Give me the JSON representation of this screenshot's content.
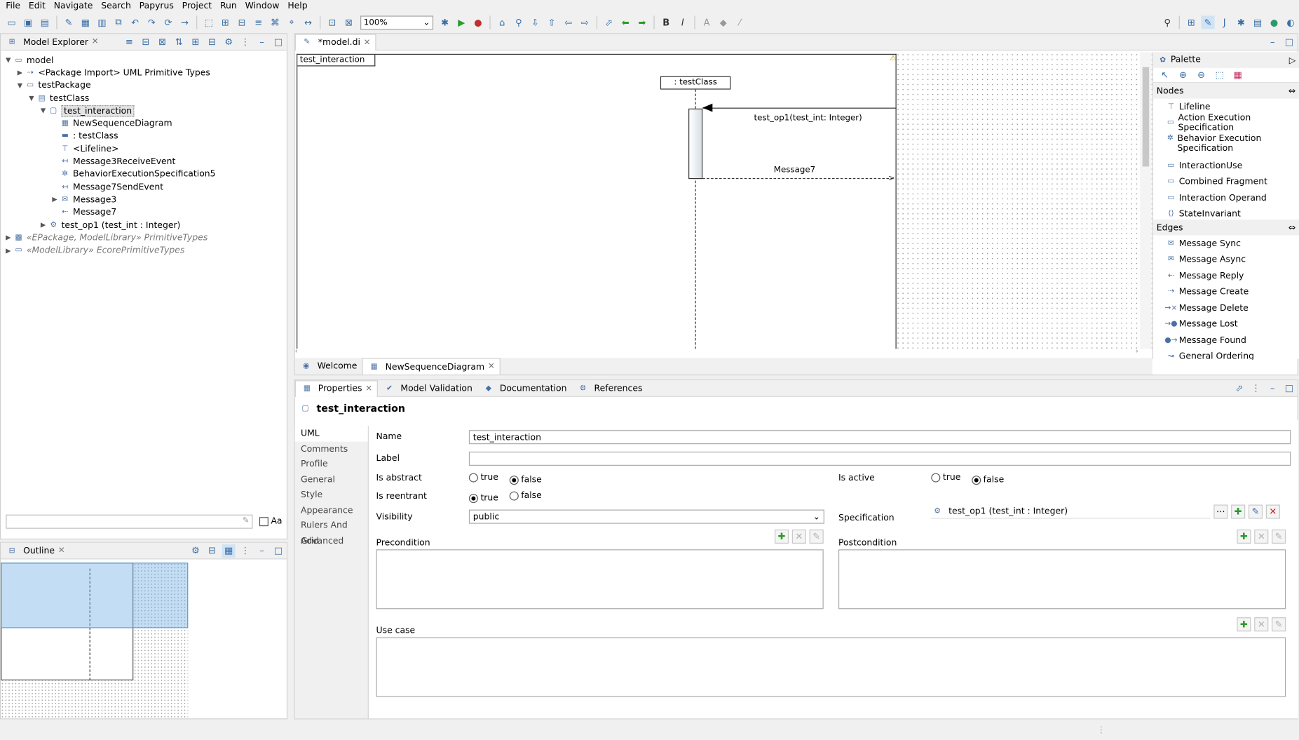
{
  "menu": [
    "File",
    "Edit",
    "Navigate",
    "Search",
    "Papyrus",
    "Project",
    "Run",
    "Window",
    "Help"
  ],
  "toolbar": {
    "zoom": "100%"
  },
  "model_explorer": {
    "title": "Model Explorer",
    "tree": [
      {
        "label": "model",
        "indent": 0,
        "exp": "v",
        "icon": "folder-icon"
      },
      {
        "label": "<Package Import> UML Primitive Types",
        "indent": 1,
        "exp": ">",
        "icon": "package-import-icon"
      },
      {
        "label": "testPackage",
        "indent": 1,
        "exp": "v",
        "icon": "package-icon"
      },
      {
        "label": "testClass",
        "indent": 2,
        "exp": "v",
        "icon": "class-icon"
      },
      {
        "label": "test_interaction",
        "indent": 3,
        "exp": "v",
        "icon": "interaction-icon",
        "selected": true
      },
      {
        "label": "NewSequenceDiagram",
        "indent": 4,
        "exp": "",
        "icon": "diagram-icon"
      },
      {
        "label": ": testClass",
        "indent": 4,
        "exp": "",
        "icon": "property-icon"
      },
      {
        "label": "<Lifeline>",
        "indent": 4,
        "exp": "",
        "icon": "lifeline-icon"
      },
      {
        "label": "Message3ReceiveEvent",
        "indent": 4,
        "exp": "",
        "icon": "event-icon"
      },
      {
        "label": "BehaviorExecutionSpecification5",
        "indent": 4,
        "exp": "",
        "icon": "execution-icon"
      },
      {
        "label": "Message7SendEvent",
        "indent": 4,
        "exp": "",
        "icon": "event-icon"
      },
      {
        "label": "Message3",
        "indent": 4,
        "exp": ">",
        "icon": "message-icon"
      },
      {
        "label": "Message7",
        "indent": 4,
        "exp": "",
        "icon": "reply-icon"
      },
      {
        "label": "test_op1 (test_int : Integer)",
        "indent": 3,
        "exp": ">",
        "icon": "operation-icon"
      },
      {
        "label": "«EPackage, ModelLibrary» PrimitiveTypes",
        "indent": 0,
        "exp": ">",
        "icon": "epackage-icon",
        "italic": true
      },
      {
        "label": "«ModelLibrary» EcorePrimitiveTypes",
        "indent": 0,
        "exp": ">",
        "icon": "model-library-icon",
        "italic": true
      }
    ],
    "filter_label": "Aa"
  },
  "outline": {
    "title": "Outline"
  },
  "editor": {
    "tab": "*model.di",
    "frame_label": "test_interaction",
    "lifeline": ": testClass",
    "msg1": "test_op1(test_int: Integer)",
    "msg2": "Message7",
    "bottom_tabs": [
      "Welcome",
      "NewSequenceDiagram"
    ]
  },
  "palette": {
    "title": "Palette",
    "nodes_title": "Nodes",
    "nodes": [
      "Lifeline",
      "Action Execution Specification",
      "Behavior Execution Specification",
      "InteractionUse",
      "Combined Fragment",
      "Interaction Operand",
      "StateInvariant"
    ],
    "edges_title": "Edges",
    "edges": [
      "Message Sync",
      "Message Async",
      "Message Reply",
      "Message Create",
      "Message Delete",
      "Message Lost",
      "Message Found",
      "General Ordering"
    ]
  },
  "properties": {
    "tabs": [
      "Properties",
      "Model Validation",
      "Documentation",
      "References"
    ],
    "title": "test_interaction",
    "side_tabs": [
      "UML",
      "Comments",
      "Profile",
      "General",
      "Style",
      "Appearance",
      "Rulers And Grid",
      "Advanced"
    ],
    "name_label": "Name",
    "name_value": "test_interaction",
    "label_label": "Label",
    "label_value": "",
    "is_abstract": "Is abstract",
    "is_active": "Is active",
    "is_reentrant": "Is reentrant",
    "true_label": "true",
    "false_label": "false",
    "visibility_label": "Visibility",
    "visibility_value": "public",
    "spec_label": "Specification",
    "spec_value": "test_op1 (test_int : Integer)",
    "precondition": "Precondition",
    "postcondition": "Postcondition",
    "use_case": "Use case"
  }
}
